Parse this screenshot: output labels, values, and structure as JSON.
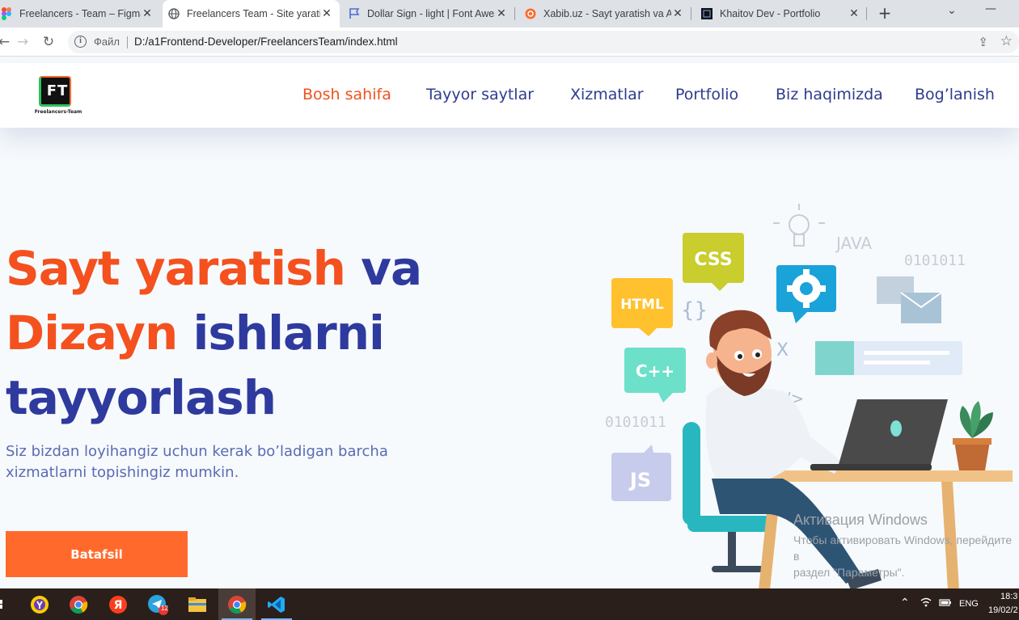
{
  "browser": {
    "tabs": [
      {
        "title": "Freelancers - Team – Figma",
        "icon": "figma-icon"
      },
      {
        "title": "Freelancers Team - Site yaratish",
        "icon": "globe-icon"
      },
      {
        "title": "Dollar Sign - light | Font Awesome",
        "icon": "flag-icon"
      },
      {
        "title": "Xabib.uz - Sayt yaratish va Avto",
        "icon": "xabib-icon"
      },
      {
        "title": "Khaitov Dev - Portfolio",
        "icon": "kd-icon"
      }
    ],
    "address": {
      "protocol_label": "Файл",
      "url": "D:/a1Frontend-Developer/FreelancersTeam/index.html"
    }
  },
  "site": {
    "logo": {
      "text": "FT",
      "caption": "Freelancers-Team"
    },
    "nav": [
      {
        "label": "Bosh sahifa",
        "active": true
      },
      {
        "label": "Tayyor saytlar",
        "active": false
      },
      {
        "label": "Xizmatlar",
        "active": false
      },
      {
        "label": "Portfolio",
        "active": false
      },
      {
        "label": "Biz haqimizda",
        "active": false
      },
      {
        "label": "Bog’lanish",
        "active": false
      }
    ],
    "hero": {
      "title_1": "Sayt yaratish",
      "title_2": "va",
      "title_3": "Dizayn",
      "title_4": "ishlarni",
      "title_5": "tayyorlash",
      "subtitle": "Siz bizdan loyihangiz uchun kerak bo’ladigan barcha xizmatlarni topishingiz mumkin.",
      "cta_label": "Batafsil"
    },
    "illustration": {
      "labels": {
        "css": "CSS",
        "html": "HTML",
        "cpp": "C++",
        "js": "JS",
        "java": "JAVA",
        "binary_1": "0101011",
        "binary_2": "0101011",
        "braces": "{}",
        "tag": "</>",
        "x": "X"
      }
    },
    "colors": {
      "accent": "#f4511e",
      "primary": "#2f3a9e",
      "button": "#ff6a2c"
    }
  },
  "watermark": {
    "line1": "Активация Windows",
    "line2": "Чтобы активировать Windows, перейдите в",
    "line3": "раздел \"Параметры\"."
  },
  "taskbar": {
    "apps": [
      {
        "name": "yandex-browser-icon"
      },
      {
        "name": "chrome-icon"
      },
      {
        "name": "yandex-icon"
      },
      {
        "name": "telegram-icon",
        "badge": "12"
      },
      {
        "name": "file-explorer-icon"
      },
      {
        "name": "chrome-icon"
      },
      {
        "name": "vscode-icon"
      }
    ],
    "tray": {
      "lang": "ENG",
      "time": "18:3",
      "date": "19/02/2"
    }
  }
}
